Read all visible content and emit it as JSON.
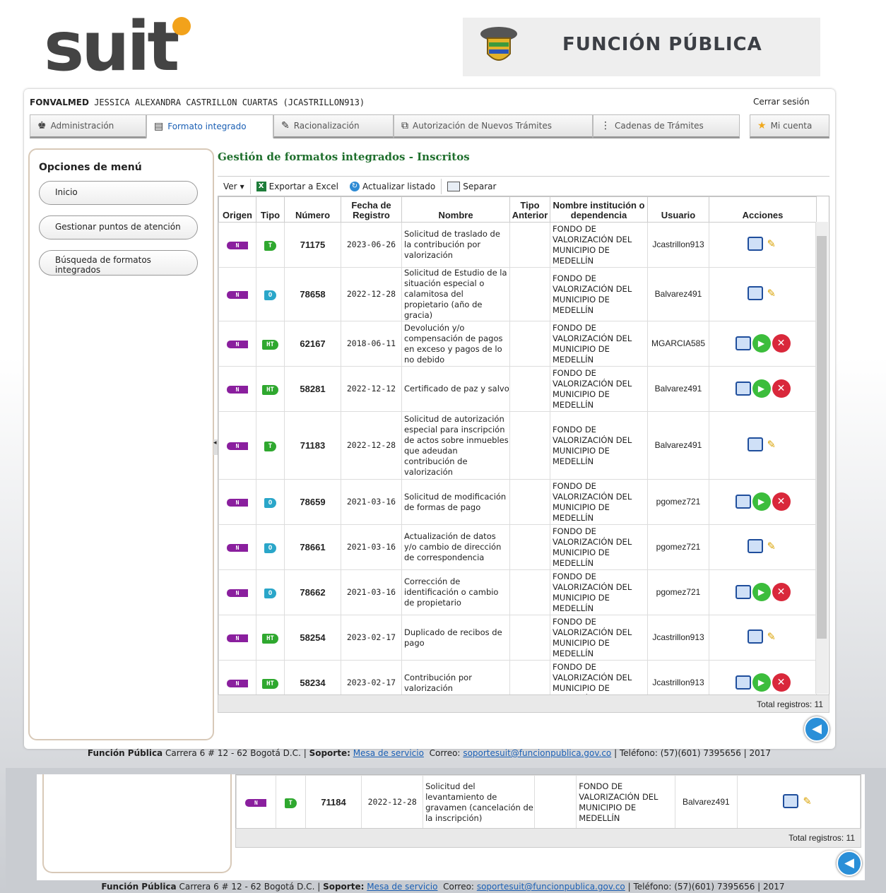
{
  "header": {
    "logo_text": "suit",
    "banner_title": "FUNCIÓN PÚBLICA"
  },
  "user": {
    "org": "FONVALMED",
    "name": "JESSICA ALEXANDRA CASTRILLON CUARTAS (JCASTRILLON913)",
    "logout": "Cerrar sesión"
  },
  "tabs": [
    {
      "label": "Administración",
      "icon": "admin-icon"
    },
    {
      "label": "Formato integrado",
      "icon": "form-icon",
      "active": true
    },
    {
      "label": "Racionalización",
      "icon": "edit-icon"
    },
    {
      "label": "Autorización de Nuevos Trámites",
      "icon": "auth-icon"
    },
    {
      "label": "Cadenas de Trámites",
      "icon": "chain-icon"
    },
    {
      "label": "Mi cuenta",
      "icon": "star-icon"
    }
  ],
  "sidebar": {
    "title": "Opciones de menú",
    "items": [
      "Inicio",
      "Gestionar puntos de atención",
      "Búsqueda de formatos integrados"
    ]
  },
  "content": {
    "title": "Gestión de formatos integrados - Inscritos",
    "toolbar": {
      "view": "Ver",
      "export": "Exportar a Excel",
      "refresh": "Actualizar listado",
      "split": "Separar"
    },
    "columns": [
      "Origen",
      "Tipo",
      "Número",
      "Fecha de Registro",
      "Nombre",
      "Tipo Anterior",
      "Nombre institución o dependencia",
      "Usuario",
      "Acciones"
    ],
    "rows": [
      {
        "origen": "N",
        "tipo": "T",
        "numero": "71175",
        "fecha": "2023-06-26",
        "nombre": "Solicitud de traslado de la contribución por valorización",
        "anterior": "",
        "institucion": "FONDO DE VALORIZACIÓN DEL MUNICIPIO DE MEDELLÍN",
        "usuario": "Jcastrillon913",
        "acciones": "edit"
      },
      {
        "origen": "N",
        "tipo": "O",
        "numero": "78658",
        "fecha": "2022-12-28",
        "nombre": "Solicitud de Estudio de la situación especial o calamitosa del propietario (año de gracia)",
        "anterior": "",
        "institucion": "FONDO DE VALORIZACIÓN DEL MUNICIPIO DE MEDELLÍN",
        "usuario": "Balvarez491",
        "acciones": "edit"
      },
      {
        "origen": "N",
        "tipo": "HT",
        "numero": "62167",
        "fecha": "2018-06-11",
        "nombre": "Devolución y/o compensación de pagos en exceso y pagos de lo no debido",
        "anterior": "",
        "institucion": "FONDO DE VALORIZACIÓN DEL MUNICIPIO DE MEDELLÍN",
        "usuario": "MGARCIA585",
        "acciones": "full"
      },
      {
        "origen": "N",
        "tipo": "HT",
        "numero": "58281",
        "fecha": "2022-12-12",
        "nombre": "Certificado de paz y salvo",
        "anterior": "",
        "institucion": "FONDO DE VALORIZACIÓN DEL MUNICIPIO DE MEDELLÍN",
        "usuario": "Balvarez491",
        "acciones": "full"
      },
      {
        "origen": "N",
        "tipo": "T",
        "numero": "71183",
        "fecha": "2022-12-28",
        "nombre": "Solicitud de autorización especial para inscripción de actos sobre inmuebles que adeudan contribución de valorización",
        "anterior": "",
        "institucion": "FONDO DE VALORIZACIÓN DEL MUNICIPIO DE MEDELLÍN",
        "usuario": "Balvarez491",
        "acciones": "edit"
      },
      {
        "origen": "N",
        "tipo": "O",
        "numero": "78659",
        "fecha": "2021-03-16",
        "nombre": "Solicitud de modificación de formas de pago",
        "anterior": "",
        "institucion": "FONDO DE VALORIZACIÓN DEL MUNICIPIO DE MEDELLÍN",
        "usuario": "pgomez721",
        "acciones": "full"
      },
      {
        "origen": "N",
        "tipo": "O",
        "numero": "78661",
        "fecha": "2021-03-16",
        "nombre": "Actualización de datos y/o cambio de dirección de correspondencia",
        "anterior": "",
        "institucion": "FONDO DE VALORIZACIÓN DEL MUNICIPIO DE MEDELLÍN",
        "usuario": "pgomez721",
        "acciones": "edit"
      },
      {
        "origen": "N",
        "tipo": "O",
        "numero": "78662",
        "fecha": "2021-03-16",
        "nombre": "Corrección de identificación o cambio de propietario",
        "anterior": "",
        "institucion": "FONDO DE VALORIZACIÓN DEL MUNICIPIO DE MEDELLÍN",
        "usuario": "pgomez721",
        "acciones": "full"
      },
      {
        "origen": "N",
        "tipo": "HT",
        "numero": "58254",
        "fecha": "2023-02-17",
        "nombre": "Duplicado de recibos de pago",
        "anterior": "",
        "institucion": "FONDO DE VALORIZACIÓN DEL MUNICIPIO DE MEDELLÍN",
        "usuario": "Jcastrillon913",
        "acciones": "edit"
      },
      {
        "origen": "N",
        "tipo": "HT",
        "numero": "58234",
        "fecha": "2023-02-17",
        "nombre": "Contribución por valorización",
        "anterior": "",
        "institucion": "FONDO DE VALORIZACIÓN DEL MUNICIPIO DE MEDELLÍN",
        "usuario": "Jcastrillon913",
        "acciones": "full"
      }
    ],
    "total": "Total registros: 11"
  },
  "extra_row": {
    "origen": "N",
    "tipo": "T",
    "numero": "71184",
    "fecha": "2022-12-28",
    "nombre": "Solicitud del levantamiento de gravamen (cancelación de la inscripción)",
    "institucion": "FONDO DE VALORIZACIÓN DEL MUNICIPIO DE MEDELLÍN",
    "usuario": "Balvarez491"
  },
  "footer": {
    "org": "Función Pública",
    "address": "Carrera 6 # 12 - 62 Bogotá D.C.",
    "support_label": "Soporte:",
    "support_link": "Mesa de servicio",
    "mail_label": "Correo:",
    "mail": "soportesuit@funcionpublica.gov.co",
    "phone": "Teléfono: (57)(601) 7395656",
    "year": "2017"
  },
  "colors": {
    "title_green": "#1f6f2d",
    "link_blue": "#1a5fb4",
    "origin_purple": "#8a1f9e",
    "type_green": "#2fa82f",
    "type_cyan": "#2aa6c9"
  }
}
